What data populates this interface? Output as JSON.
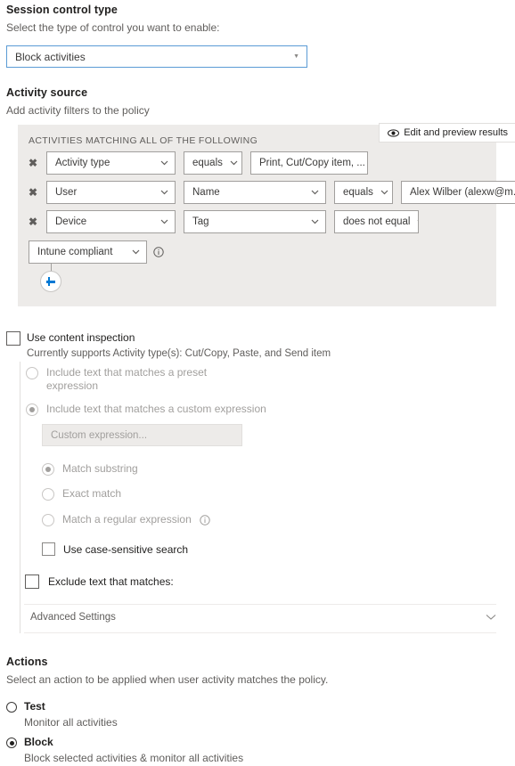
{
  "session_control": {
    "title": "Session control type",
    "subtitle": "Select the type of control you want to enable:",
    "dropdown_value": "Block activities",
    "caret_icon": "caret-down-icon"
  },
  "activity_source": {
    "title": "Activity source",
    "subtitle": "Add activity filters to the policy",
    "panel_label": "ACTIVITIES MATCHING ALL OF THE FOLLOWING",
    "edit_preview_label": "Edit and preview results",
    "edit_preview_icon": "eye-icon",
    "remove_icon": "remove-filter-icon",
    "add_icon": "add-filter-icon",
    "info_icon": "info-icon",
    "chevron_icon": "chevron-down-icon",
    "filters": [
      {
        "field": "Activity type",
        "operator": "equals",
        "value": "Print, Cut/Copy item, ..."
      },
      {
        "field": "User",
        "property": "Name",
        "operator": "equals",
        "value": "Alex Wilber (alexw@m..."
      },
      {
        "field": "Device",
        "property": "Tag",
        "operator": "does not equal",
        "value": "Intune compliant"
      }
    ]
  },
  "content_inspection": {
    "checkbox_label": "Use content inspection",
    "checkbox_checked": false,
    "support_note": "Currently supports Activity type(s): Cut/Copy, Paste, and Send item",
    "option_preset": "Include text that matches a preset expression",
    "option_preset_line1": "Include text that matches a preset",
    "option_preset_line2": "expression",
    "option_custom": "Include text that matches a custom expression",
    "custom_expression_placeholder": "Custom expression...",
    "custom_expression_value": "",
    "match_substring": "Match substring",
    "exact_match": "Exact match",
    "match_regex": "Match a regular expression",
    "case_sensitive": "Use case-sensitive search",
    "exclude_text": "Exclude text that matches:",
    "advanced_settings": "Advanced Settings",
    "selected_include_option": "custom",
    "selected_match_option": "substring"
  },
  "actions": {
    "title": "Actions",
    "subtitle": "Select an action to be applied when user activity matches the policy.",
    "options": [
      {
        "label": "Test",
        "description": "Monitor all activities",
        "selected": false
      },
      {
        "label": "Block",
        "description": "Block selected activities & monitor all activities",
        "selected": true
      }
    ]
  },
  "colors": {
    "accent": "#0078d4",
    "focus_border": "#5b9bd5",
    "panel_bg": "#edebe9",
    "text_primary": "#201f1e",
    "text_secondary": "#605e5c",
    "disabled": "#a19f9d"
  }
}
